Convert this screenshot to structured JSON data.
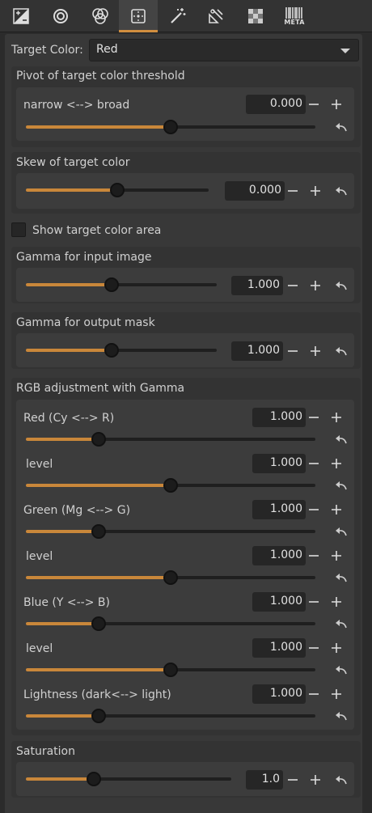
{
  "toolbar": {
    "tabs": [
      {
        "icon": "exposure-icon",
        "active": false
      },
      {
        "icon": "detail-icon",
        "active": false
      },
      {
        "icon": "color-icon",
        "active": false
      },
      {
        "icon": "local-adjust-icon",
        "active": true
      },
      {
        "icon": "magic-wand-icon",
        "active": false
      },
      {
        "icon": "transform-icon",
        "active": false
      },
      {
        "icon": "raw-icon",
        "active": false
      },
      {
        "icon": "metadata-icon",
        "active": false
      }
    ],
    "meta_label": "META"
  },
  "target_color": {
    "label": "Target Color:",
    "value": "Red"
  },
  "pivot": {
    "title": "Pivot of target color threshold",
    "slider_label": "narrow <--> broad",
    "value": "0.000",
    "position": 0.5
  },
  "skew": {
    "title": "Skew of target color",
    "value": "0.000",
    "position": 0.5
  },
  "show_area": {
    "label": "Show target color area",
    "checked": false
  },
  "gamma_input": {
    "title": "Gamma for input image",
    "value": "1.000",
    "position": 0.45
  },
  "gamma_output": {
    "title": "Gamma for output mask",
    "value": "1.000",
    "position": 0.45
  },
  "rgb": {
    "title": "RGB adjustment with Gamma",
    "rows": [
      {
        "label": "Red (Cy <--> R)",
        "value": "1.000",
        "position": 0.25
      },
      {
        "label": "level",
        "value": "1.000",
        "position": 0.5
      },
      {
        "label": "Green (Mg <--> G)",
        "value": "1.000",
        "position": 0.25
      },
      {
        "label": "level",
        "value": "1.000",
        "position": 0.5
      },
      {
        "label": "Blue  (Y <--> B)",
        "value": "1.000",
        "position": 0.25
      },
      {
        "label": "level",
        "value": "1.000",
        "position": 0.5
      },
      {
        "label": "Lightness (dark<--> light)",
        "value": "1.000",
        "position": 0.25
      }
    ]
  },
  "saturation": {
    "title": "Saturation",
    "value": "1.0",
    "position": 0.33
  },
  "colors": {
    "accent": "#c9873a",
    "panel": "#383838",
    "background": "#2b2b2b"
  }
}
